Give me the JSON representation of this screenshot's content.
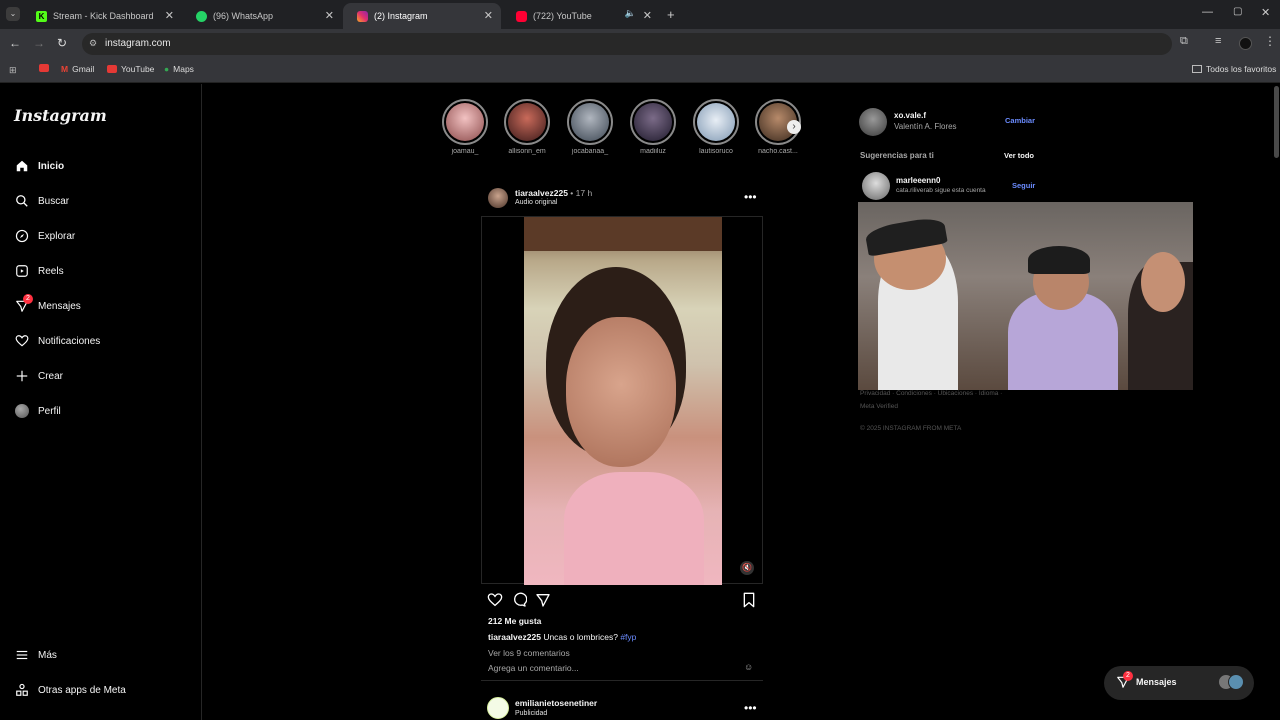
{
  "browser": {
    "tabs": [
      {
        "label": "Stream - Kick Dashboard",
        "color": "#53fc18"
      },
      {
        "label": "(96) WhatsApp",
        "color": "#25d366"
      },
      {
        "label": "(2) Instagram",
        "color": "#e1306c"
      },
      {
        "label": "(722) YouTube",
        "color": "#ff0033"
      }
    ],
    "url": "instagram.com",
    "bookmarks": [
      "Gmail",
      "YouTube",
      "Maps"
    ],
    "all_bookmarks": "Todos los favoritos"
  },
  "sidebar": {
    "logo": "Instagram",
    "items": [
      {
        "label": "Inicio",
        "icon": "home-icon"
      },
      {
        "label": "Buscar",
        "icon": "search-icon"
      },
      {
        "label": "Explorar",
        "icon": "compass-icon"
      },
      {
        "label": "Reels",
        "icon": "reels-icon"
      },
      {
        "label": "Mensajes",
        "icon": "messages-icon",
        "badge": "2"
      },
      {
        "label": "Notificaciones",
        "icon": "heart-icon"
      },
      {
        "label": "Crear",
        "icon": "plus-icon"
      },
      {
        "label": "Perfil",
        "icon": "avatar"
      }
    ],
    "more": "Más",
    "meta_apps": "Otras apps de Meta"
  },
  "stories": [
    "joamau_",
    "allisonn_em",
    "jocabanaa_",
    "madiiluz",
    "lautisoruco",
    "nacho.cast..."
  ],
  "post": {
    "username": "tiaraalvez225",
    "time": "17 h",
    "audio": "Audio original",
    "likes": "212 Me gusta",
    "caption_user": "tiaraalvez225",
    "caption": "Uncas o lombrices?",
    "hashtag": "#fyp",
    "comments": "Ver los 9 comentarios",
    "add_comment": "Agrega un comentario..."
  },
  "next_post": {
    "username": "emilianietosenetiner",
    "label": "Publicidad"
  },
  "right": {
    "username": "xo.vale.f",
    "fullname": "Valentín A. Flores",
    "switch": "Cambiar",
    "suggestions": "Sugerencias para ti",
    "see_all": "Ver todo",
    "suggested_user": "marleeenn0",
    "suggested_sub": "cata.riliverab sigue esta cuenta",
    "follow": "Seguir",
    "footer1": "Privacidad · Condiciones · Ubicaciones · Idioma ·",
    "footer2": "Meta Verified",
    "copyright": "© 2025 INSTAGRAM FROM META"
  },
  "messages_pill": {
    "label": "Mensajes",
    "badge": "2"
  }
}
